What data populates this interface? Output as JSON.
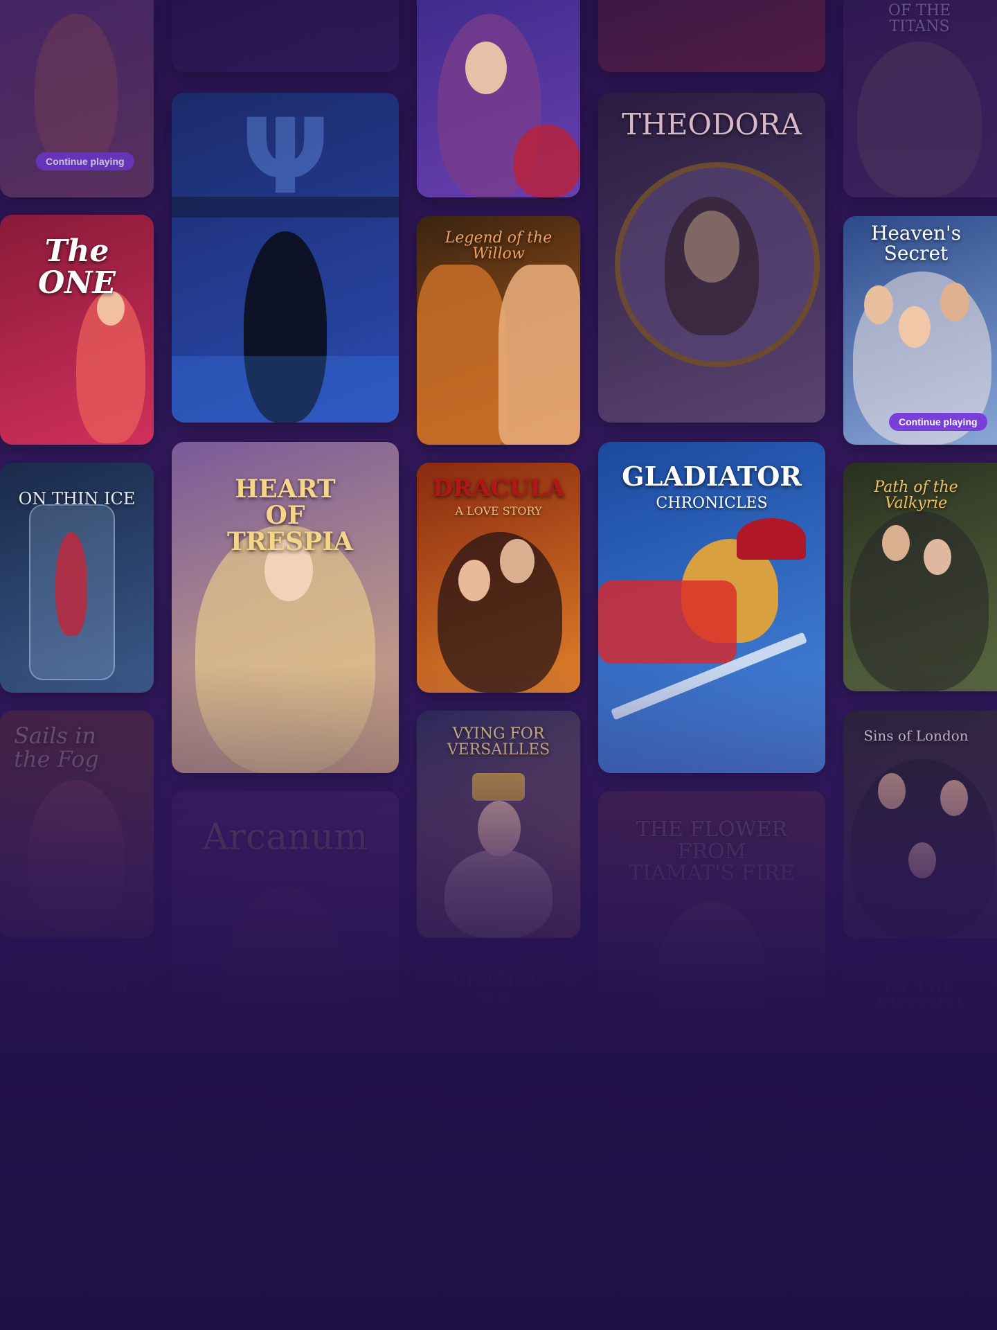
{
  "cards": [
    {
      "id": "c1",
      "title": "",
      "badge": "Continue playing",
      "colors": [
        "#6a3f86",
        "#9a5b6e"
      ],
      "faded": true
    },
    {
      "id": "c2",
      "title": "",
      "badge": "",
      "colors": [
        "#241846",
        "#3a2468"
      ],
      "faded": true
    },
    {
      "id": "c3",
      "title": "",
      "badge": "",
      "colors": [
        "#3d2b8a",
        "#6a3fb0"
      ],
      "faded": false
    },
    {
      "id": "c4",
      "title": "",
      "badge": "",
      "colors": [
        "#5a1e3a",
        "#8a2a3a"
      ],
      "faded": true
    },
    {
      "id": "c5",
      "title": "OF THE TITANS",
      "badge": "",
      "colors": [
        "#3a2456",
        "#5a3a70"
      ],
      "faded": true
    },
    {
      "id": "c6",
      "title": "",
      "badge": "",
      "glyph": "Ψ",
      "colors": [
        "#1b2a6a",
        "#2b4ab0"
      ],
      "faded": false
    },
    {
      "id": "c7",
      "title": "The ONE",
      "badge": "",
      "colors": [
        "#8a1a3a",
        "#d0305a"
      ],
      "faded": false
    },
    {
      "id": "c8",
      "title": "Legend of the Willow",
      "badge": "",
      "colors": [
        "#3a2410",
        "#c06020"
      ],
      "faded": false
    },
    {
      "id": "c9",
      "title": "THEODORA",
      "badge": "",
      "colors": [
        "#2a1c40",
        "#5a4470"
      ],
      "faded": false
    },
    {
      "id": "c10",
      "title": "Heaven's Secret",
      "badge": "Continue playing",
      "colors": [
        "#2c4a8a",
        "#8aa8d8"
      ],
      "faded": false
    },
    {
      "id": "c11",
      "title": "ON THIN ICE",
      "badge": "",
      "colors": [
        "#1a2a4a",
        "#3a5a8a"
      ],
      "faded": false
    },
    {
      "id": "c12",
      "title": "HEART OF TRESPIA",
      "badge": "",
      "colors": [
        "#7a5a9a",
        "#d8b080"
      ],
      "faded": false
    },
    {
      "id": "c13",
      "title": "DRACULA",
      "subtitle": "A LOVE STORY",
      "badge": "",
      "colors": [
        "#8a2a10",
        "#e0802a"
      ],
      "faded": false
    },
    {
      "id": "c14",
      "title": "GLADIATOR",
      "subtitle": "CHRONICLES",
      "badge": "",
      "colors": [
        "#1a4aa0",
        "#4a8ae0"
      ],
      "faded": false
    },
    {
      "id": "c15",
      "title": "Path of the Valkyrie",
      "badge": "",
      "colors": [
        "#2a3020",
        "#5a6a40"
      ],
      "faded": false
    },
    {
      "id": "c16",
      "title": "Sails in the Fog",
      "badge": "",
      "colors": [
        "#6a3a2a",
        "#a06040"
      ],
      "faded": true
    },
    {
      "id": "c17",
      "title": "VYING FOR VERSAILLES",
      "badge": "",
      "colors": [
        "#2a2a5a",
        "#a07060"
      ],
      "faded": false
    },
    {
      "id": "c18",
      "title": "Sins of London",
      "badge": "",
      "colors": [
        "#2a2436",
        "#4a3a4a"
      ],
      "faded": false
    },
    {
      "id": "c19",
      "title": "Arcanum",
      "badge": "",
      "colors": [
        "#4a2a7a",
        "#8a4aa0"
      ],
      "faded": true
    },
    {
      "id": "c20",
      "title": "THE FLOWER FROM TIAMAT'S FIRE",
      "badge": "",
      "colors": [
        "#6a3a3a",
        "#a06a50"
      ],
      "faded": true
    },
    {
      "id": "c21",
      "title": "Moonborn",
      "badge": "",
      "colors": [
        "#3a2a5a",
        "#5a4a7a"
      ],
      "faded": true
    },
    {
      "id": "c22",
      "title": "CHASING YOU",
      "badge": "",
      "colors": [
        "#3a2a5a",
        "#5a3a6a"
      ],
      "faded": true
    },
    {
      "id": "c23",
      "title": "BY THE RHYTHM",
      "badge": "",
      "colors": [
        "#3a2a6a",
        "#5a3a8a"
      ],
      "faded": true
    },
    {
      "id": "c24",
      "title": "",
      "badge": "",
      "colors": [
        "#3a225e",
        "#4a2c6e"
      ],
      "faded": true
    },
    {
      "id": "c25",
      "title": "",
      "badge": "",
      "colors": [
        "#3a225e",
        "#4a2c6e"
      ],
      "faded": true
    },
    {
      "id": "c26",
      "title": "",
      "badge": "",
      "colors": [
        "#3a225e",
        "#4a2c6e"
      ],
      "faded": true
    }
  ],
  "accent_color": "#7a3ed9",
  "background_colors": [
    "#2a1450",
    "#1e1244"
  ]
}
